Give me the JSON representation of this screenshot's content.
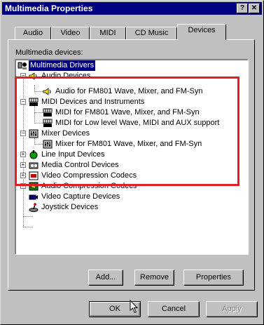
{
  "window": {
    "title": "Multimedia Properties",
    "help_glyph": "?",
    "close_glyph": "✕"
  },
  "tabs": [
    {
      "label": "Audio",
      "active": false
    },
    {
      "label": "Video",
      "active": false
    },
    {
      "label": "MIDI",
      "active": false
    },
    {
      "label": "CD Music",
      "active": false
    },
    {
      "label": "Devices",
      "active": true
    }
  ],
  "devices_label": "Multimedia devices:",
  "tree": {
    "root": "Multimedia Drivers",
    "audio_devices": "Audio Devices",
    "audio_fm801": "Audio for FM801 Wave, Mixer, and FM-Syn",
    "midi_devices": "MIDI Devices and Instruments",
    "midi_fm801": "MIDI for FM801 Wave, Mixer, and FM-Syn",
    "midi_low": "MIDI for Low level Wave, MIDI and AUX support",
    "mixer_devices": "Mixer Devices",
    "mixer_fm801": "Mixer for FM801 Wave, Mixer, and FM-Syn",
    "line_input": "Line Input Devices",
    "media_control": "Media Control Devices",
    "video_codecs": "Video Compression Codecs",
    "audio_codecs": "Audio Compression Codecs",
    "video_capture": "Video Capture Devices",
    "joystick": "Joystick Devices"
  },
  "buttons": {
    "add": "Add...",
    "remove": "Remove",
    "properties": "Properties",
    "ok": "OK",
    "cancel": "Cancel",
    "apply": "Apply"
  },
  "colors": {
    "titlebar": "#000080",
    "face": "#c0c0c0",
    "selection": "#000080",
    "highlight_box": "#e51c23"
  }
}
